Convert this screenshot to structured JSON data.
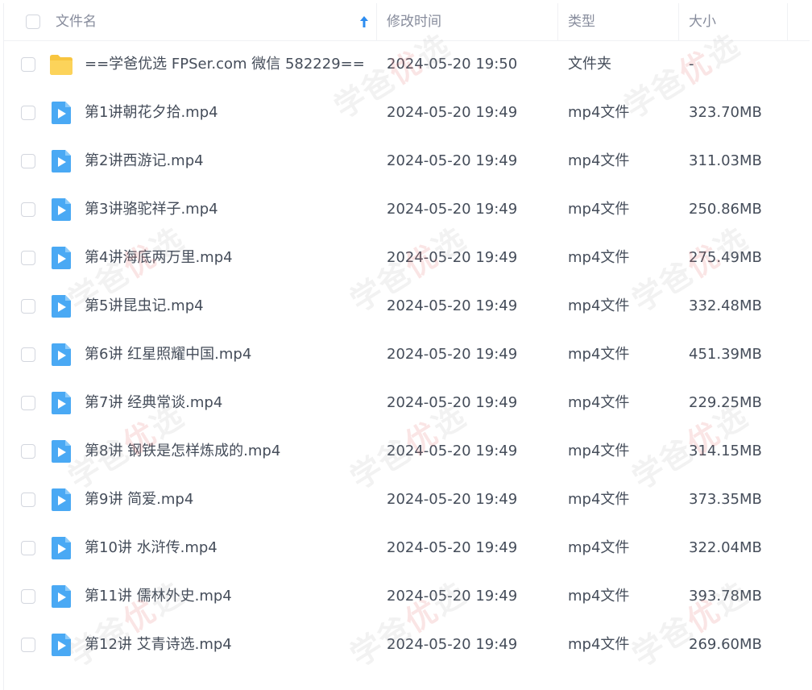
{
  "header": {
    "name_label": "文件名",
    "time_label": "修改时间",
    "type_label": "类型",
    "size_label": "大小"
  },
  "files": [
    {
      "name": "==学爸优选 FPSer.com 微信 582229==",
      "time": "2024-05-20 19:50",
      "type": "文件夹",
      "size": "-",
      "icon": "folder-icon"
    },
    {
      "name": "第1讲朝花夕拾.mp4",
      "time": "2024-05-20 19:49",
      "type": "mp4文件",
      "size": "323.70MB",
      "icon": "video-file-icon"
    },
    {
      "name": "第2讲西游记.mp4",
      "time": "2024-05-20 19:49",
      "type": "mp4文件",
      "size": "311.03MB",
      "icon": "video-file-icon"
    },
    {
      "name": "第3讲骆驼祥子.mp4",
      "time": "2024-05-20 19:49",
      "type": "mp4文件",
      "size": "250.86MB",
      "icon": "video-file-icon"
    },
    {
      "name": "第4讲海底两万里.mp4",
      "time": "2024-05-20 19:49",
      "type": "mp4文件",
      "size": "275.49MB",
      "icon": "video-file-icon"
    },
    {
      "name": "第5讲昆虫记.mp4",
      "time": "2024-05-20 19:49",
      "type": "mp4文件",
      "size": "332.48MB",
      "icon": "video-file-icon"
    },
    {
      "name": "第6讲 红星照耀中国.mp4",
      "time": "2024-05-20 19:49",
      "type": "mp4文件",
      "size": "451.39MB",
      "icon": "video-file-icon"
    },
    {
      "name": "第7讲 经典常谈.mp4",
      "time": "2024-05-20 19:49",
      "type": "mp4文件",
      "size": "229.25MB",
      "icon": "video-file-icon"
    },
    {
      "name": "第8讲 钢铁是怎样炼成的.mp4",
      "time": "2024-05-20 19:49",
      "type": "mp4文件",
      "size": "314.15MB",
      "icon": "video-file-icon"
    },
    {
      "name": "第9讲 简爱.mp4",
      "time": "2024-05-20 19:49",
      "type": "mp4文件",
      "size": "373.35MB",
      "icon": "video-file-icon"
    },
    {
      "name": "第10讲 水浒传.mp4",
      "time": "2024-05-20 19:49",
      "type": "mp4文件",
      "size": "322.04MB",
      "icon": "video-file-icon"
    },
    {
      "name": "第11讲 儒林外史.mp4",
      "time": "2024-05-20 19:49",
      "type": "mp4文件",
      "size": "393.78MB",
      "icon": "video-file-icon"
    },
    {
      "name": "第12讲 艾青诗选.mp4",
      "time": "2024-05-20 19:49",
      "type": "mp4文件",
      "size": "269.60MB",
      "icon": "video-file-icon"
    }
  ],
  "watermark": {
    "pre": "学爸",
    "highlight": "优",
    "post": "选"
  },
  "colors": {
    "folder": "#f8c53f",
    "video": "#4aa9f4",
    "sort_arrow": "#2d8cf0",
    "text": "#454d5a",
    "header_text": "#878c9c"
  }
}
